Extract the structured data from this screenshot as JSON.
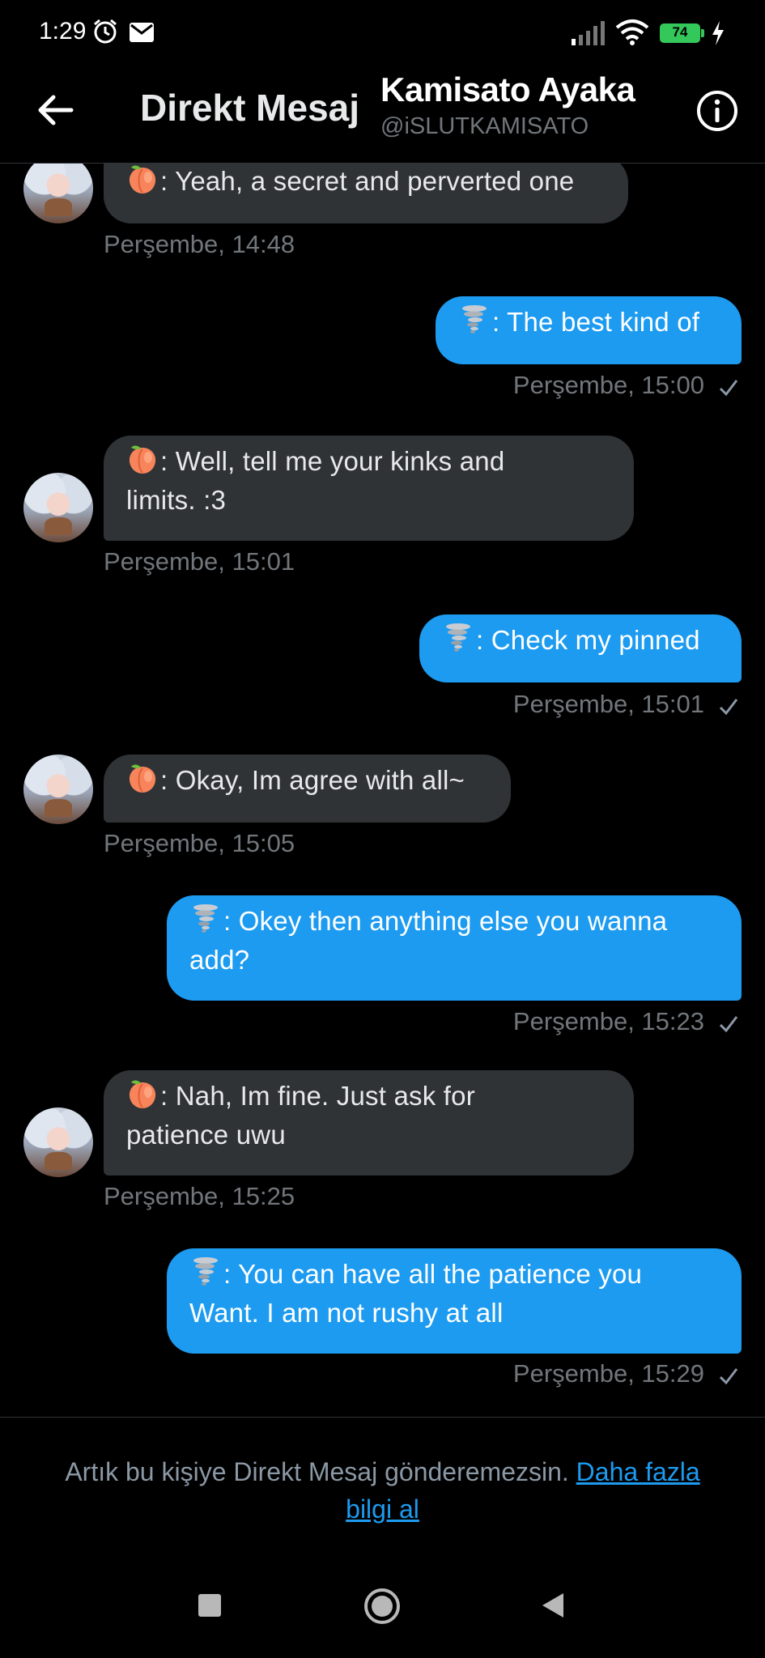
{
  "status_bar": {
    "time": "1:29",
    "battery": "74",
    "icons": [
      "alarm-icon",
      "mail-icon",
      "signal-icon",
      "wifi-icon",
      "battery-icon",
      "charging-icon"
    ]
  },
  "header": {
    "title": "Direkt Mesaj",
    "contact_name": "Kamisato Ayaka",
    "contact_handle": "@iSLUTKAMISATO"
  },
  "messages": [
    {
      "side": "in",
      "text": ": Yeah, a secret and perverted one",
      "time": "Perşembe, 14:48"
    },
    {
      "side": "out",
      "text": ": The best kind of",
      "time": "Perşembe, 15:00"
    },
    {
      "side": "in",
      "text_line1": ": Well, tell me your kinks and",
      "text_line2": "limits. :3",
      "time": "Perşembe, 15:01"
    },
    {
      "side": "out",
      "text": ": Check my pinned",
      "time": "Perşembe, 15:01"
    },
    {
      "side": "in",
      "text": ": Okay, Im agree with all~",
      "time": "Perşembe, 15:05"
    },
    {
      "side": "out",
      "text_line1": ": Okey then anything else you wanna",
      "text_line2": "add?",
      "time": "Perşembe, 15:23"
    },
    {
      "side": "in",
      "text_line1": ": Nah, Im fine. Just ask for",
      "text_line2": "patience uwu",
      "time": "Perşembe, 15:25"
    },
    {
      "side": "out",
      "text_line1": ": You can have all the patience you",
      "text_line2": "Want. I am not rushy at all",
      "time": "Perşembe, 15:29"
    }
  ],
  "footer": {
    "notice": "Artık bu kişiye Direkt Mesaj gönderemezsin.",
    "link_line1": "Daha fazla",
    "link_line2": "bilgi al"
  },
  "colors": {
    "background": "#000000",
    "accent": "#1d9bf0",
    "incoming_bubble": "#2f3336",
    "meta_text": "#71767b"
  }
}
